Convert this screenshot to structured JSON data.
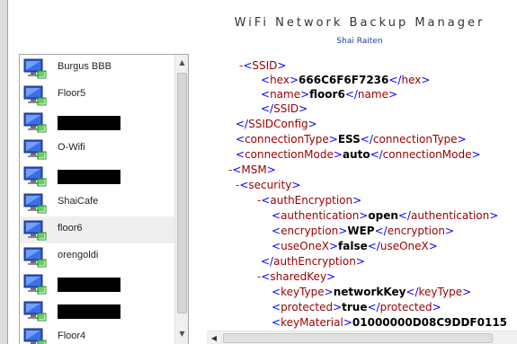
{
  "header": {
    "title": "WiFi Network Backup Manager",
    "subtitle": "Shai Raiten"
  },
  "networks": [
    {
      "label": "Burgus BBB",
      "redacted": false
    },
    {
      "label": "Floor5",
      "redacted": false
    },
    {
      "label": "",
      "redacted": true
    },
    {
      "label": "O-Wifi",
      "redacted": false
    },
    {
      "label": "",
      "redacted": true
    },
    {
      "label": "ShaiCafe",
      "redacted": false
    },
    {
      "label": "floor6",
      "redacted": false,
      "selected": true
    },
    {
      "label": "orengoldi",
      "redacted": false
    },
    {
      "label": "",
      "redacted": true
    },
    {
      "label": "",
      "redacted": true
    },
    {
      "label": "Floor4",
      "redacted": false
    }
  ],
  "network_icon": "wireless-network-icon",
  "xml": {
    "lines": [
      {
        "minus": true,
        "parts": [
          "<",
          "SSID",
          ">"
        ]
      },
      {
        "open": "hex",
        "value": "666C6F6F7236",
        "close": "hex"
      },
      {
        "open": "name",
        "value": "floor6",
        "close": "name"
      },
      {
        "parts": [
          "</",
          "SSID",
          ">"
        ]
      },
      {
        "parts": [
          "</",
          "SSIDConfig",
          ">"
        ]
      },
      {
        "open": "connectionType",
        "value": "ESS",
        "close": "connectionType"
      },
      {
        "open": "connectionMode",
        "value": "auto",
        "close": "connectionMode"
      },
      {
        "minus": true,
        "parts": [
          "<",
          "MSM",
          ">"
        ]
      },
      {
        "minus": true,
        "parts": [
          "<",
          "security",
          ">"
        ]
      },
      {
        "minus": true,
        "parts": [
          "<",
          "authEncryption",
          ">"
        ]
      },
      {
        "open": "authentication",
        "value": "open",
        "close": "authentication"
      },
      {
        "open": "encryption",
        "value": "WEP",
        "close": "encryption"
      },
      {
        "open": "useOneX",
        "value": "false",
        "close": "useOneX"
      },
      {
        "parts": [
          "</",
          "authEncryption",
          ">"
        ]
      },
      {
        "minus": true,
        "parts": [
          "<",
          "sharedKey",
          ">"
        ]
      },
      {
        "open": "keyType",
        "value": "networkKey",
        "close": "keyType"
      },
      {
        "open": "protected",
        "value": "true",
        "close": "protected"
      },
      {
        "open": "keyMaterial",
        "value": "01000000D08C9DDF0115",
        "close": ""
      }
    ],
    "colors": {
      "minus": "#ff0000",
      "bracket": "#0000ff",
      "tag": "#990000",
      "value": "#000000"
    }
  },
  "scrollbar": {
    "up_icon": "scroll-up-icon",
    "down_icon": "scroll-down-icon",
    "left_icon": "scroll-left-icon"
  }
}
